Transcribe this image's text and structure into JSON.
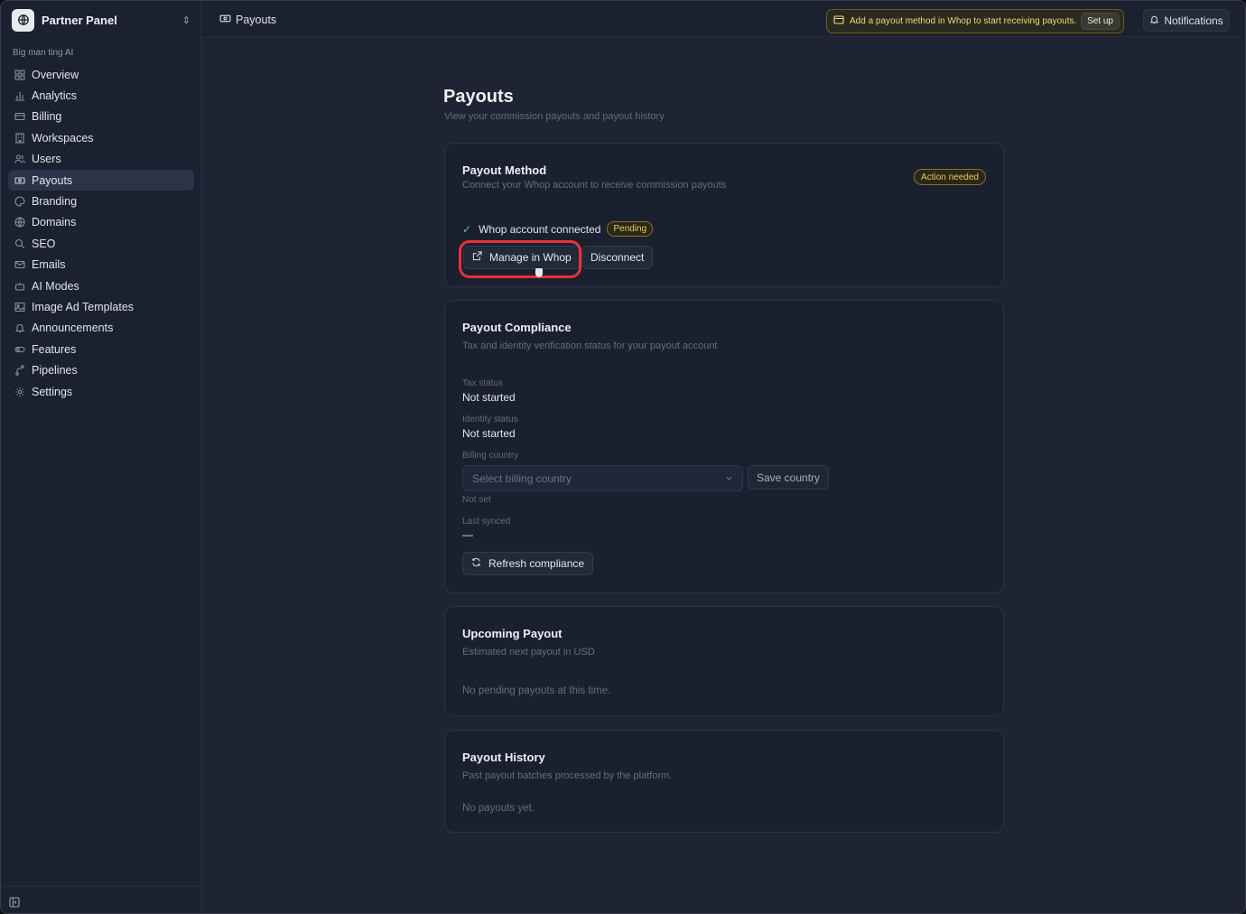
{
  "sidebar": {
    "app_name": "Partner Panel",
    "group_label": "Big man ting AI",
    "items": [
      {
        "label": "Overview",
        "icon": "grid-icon"
      },
      {
        "label": "Analytics",
        "icon": "bar-chart-icon"
      },
      {
        "label": "Billing",
        "icon": "credit-card-icon"
      },
      {
        "label": "Workspaces",
        "icon": "building-icon"
      },
      {
        "label": "Users",
        "icon": "users-icon"
      },
      {
        "label": "Payouts",
        "icon": "banknote-icon",
        "active": true
      },
      {
        "label": "Branding",
        "icon": "palette-icon"
      },
      {
        "label": "Domains",
        "icon": "globe-icon"
      },
      {
        "label": "SEO",
        "icon": "search-icon"
      },
      {
        "label": "Emails",
        "icon": "mail-icon"
      },
      {
        "label": "AI Modes",
        "icon": "bot-icon"
      },
      {
        "label": "Image Ad Templates",
        "icon": "image-icon"
      },
      {
        "label": "Announcements",
        "icon": "bell-icon"
      },
      {
        "label": "Features",
        "icon": "toggle-icon"
      },
      {
        "label": "Pipelines",
        "icon": "pipeline-icon"
      },
      {
        "label": "Settings",
        "icon": "gear-icon"
      }
    ]
  },
  "topbar": {
    "breadcrumb": "Payouts",
    "banner_text": "Add a payout method in Whop to start receiving payouts.",
    "banner_button": "Set up",
    "notifications": "Notifications"
  },
  "page": {
    "title": "Payouts",
    "subtitle": "View your commission payouts and payout history"
  },
  "payout_method": {
    "title": "Payout Method",
    "subtitle": "Connect your Whop account to receive commission payouts",
    "badge": "Action needed",
    "status_text": "Whop account connected",
    "status_badge": "Pending",
    "manage_button": "Manage in Whop",
    "disconnect_button": "Disconnect"
  },
  "compliance": {
    "title": "Payout Compliance",
    "subtitle": "Tax and identity verification status for your payout account",
    "tax_label": "Tax status",
    "tax_value": "Not started",
    "identity_label": "Identity status",
    "identity_value": "Not started",
    "country_label": "Billing country",
    "country_placeholder": "Select billing country",
    "save_country": "Save country",
    "country_note": "Not set",
    "synced_label": "Last synced",
    "synced_value": "—",
    "refresh_button": "Refresh compliance"
  },
  "upcoming": {
    "title": "Upcoming Payout",
    "subtitle": "Estimated next payout in USD",
    "empty": "No pending payouts at this time."
  },
  "history": {
    "title": "Payout History",
    "subtitle": "Past payout batches processed by the platform.",
    "empty": "No payouts yet."
  }
}
